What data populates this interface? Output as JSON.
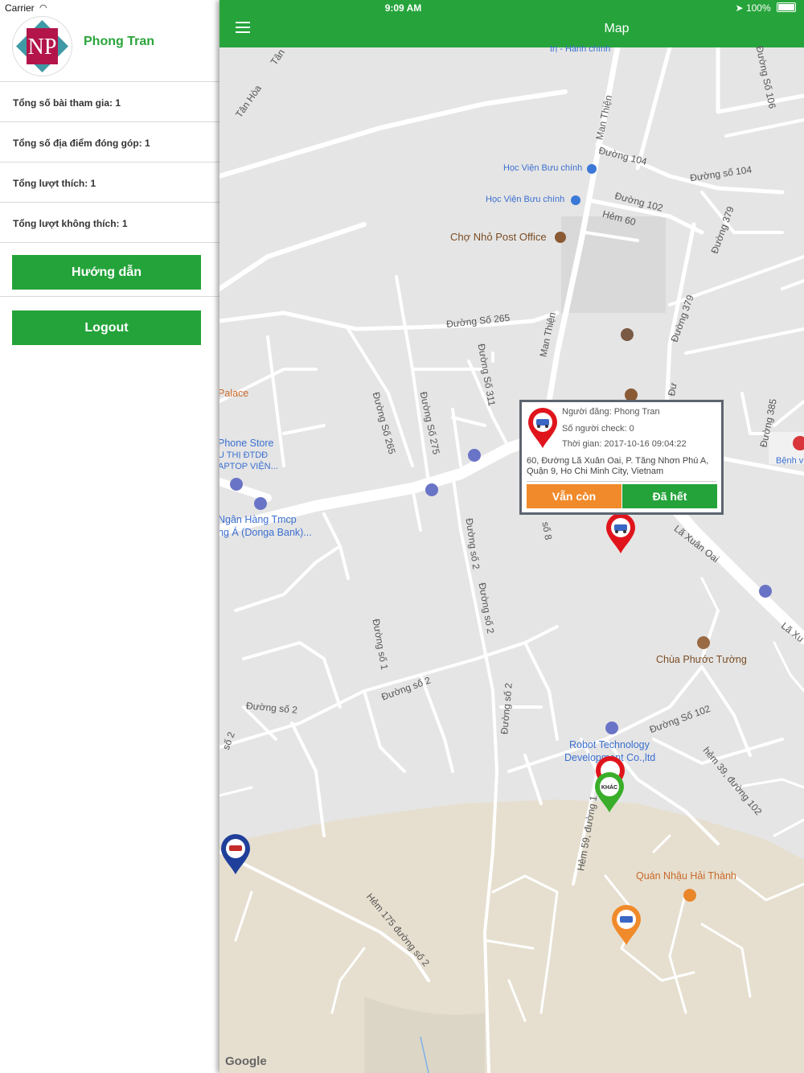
{
  "status_bar": {
    "carrier": "Carrier",
    "time": "9:09 AM",
    "battery": "100%"
  },
  "drawer": {
    "user_name": "Phong Tran",
    "avatar_initials": "NP",
    "stats": [
      "Tổng số bài tham gia: 1",
      "Tổng số địa điểm đóng góp: 1",
      "Tổng lượt thích: 1",
      "Tổng lượt không thích: 1"
    ],
    "guide_button": "Hướng dẫn",
    "logout_button": "Logout"
  },
  "navbar": {
    "title": "Map"
  },
  "map": {
    "street_labels": [
      "Đường 104",
      "Đường số 104",
      "Đường 102",
      "Hẻm 60",
      "Đường 379",
      "Đường 379",
      "Đường Số 265",
      "Đường Số 265",
      "Đường Số 275",
      "Đường Số 311",
      "Man Thiện",
      "Man Thiện",
      "Lã Xuân Oai",
      "Lã Xu",
      "Đường Số 106",
      "Đường 385",
      "Đường số 2",
      "Đường số 2",
      "Đường số 2",
      "Đường số 2",
      "Đường số 2",
      "Đường số 1",
      "Đường Số 102",
      "hẻm 39, đường 102",
      "Hẻm 59, đường 1",
      "Hẻm 175 đường số 2",
      "Tân Hòa",
      "Tân",
      "số 8",
      "số 2",
      "Đư"
    ],
    "poi_labels": [
      "trị - Hành chính",
      "Học Viện Bưu chính",
      "Học Viện Bưu chính",
      "Chợ Nhỏ Post Office",
      "Palace",
      "Phone Store",
      "U THỊ ĐTDĐ",
      "APTOP VIỆN...",
      "Ngân Hàng Tmcp",
      "ng Á (Donga Bank)...",
      "Chùa Phước Tường",
      "Robot Technology",
      "Development Co.,ltd",
      "Quán Nhậu Hải Thành",
      "Bệnh v"
    ],
    "popup": {
      "poster": "Người đăng: Phong Tran",
      "check_count": "Số người check: 0",
      "time": "Thời gian: 2017-10-16 09:04:22",
      "address_line1": "60, Đường Lã Xuân Oai, P. Tăng Nhơn Phú A,",
      "address_line2": "Quận 9, Ho Chi Minh City, Vietnam",
      "still_button": "Vẫn còn",
      "gone_button": "Đã hết"
    },
    "marker_badge": "KHÁC",
    "attribution": "Google",
    "colors": {
      "green": "#24a33a",
      "orange": "#f08a2a",
      "red": "#e0141c",
      "blue": "#1f3f9a",
      "lime": "#3aae2a"
    }
  }
}
